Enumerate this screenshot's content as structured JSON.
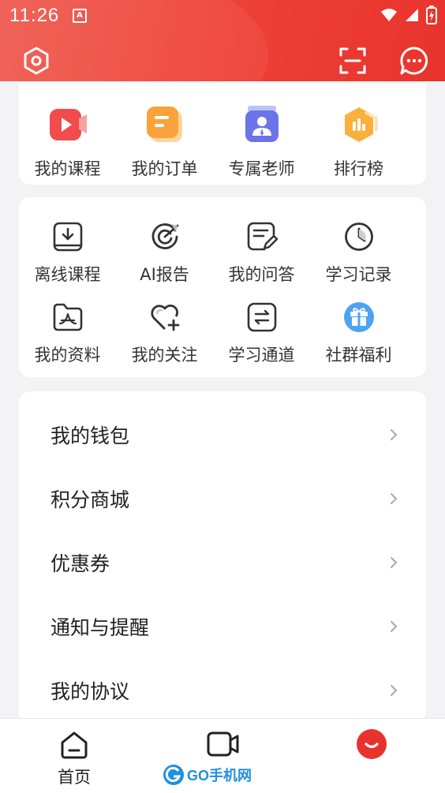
{
  "status_bar": {
    "time": "11:26",
    "app_badge": "A"
  },
  "top_actions": [
    {
      "label": "我的课程",
      "icon": "video-course-icon"
    },
    {
      "label": "我的订单",
      "icon": "order-icon"
    },
    {
      "label": "专属老师",
      "icon": "teacher-icon"
    },
    {
      "label": "排行榜",
      "icon": "ranking-icon"
    }
  ],
  "tools": [
    {
      "label": "离线课程",
      "icon": "download-icon"
    },
    {
      "label": "AI报告",
      "icon": "ai-report-icon"
    },
    {
      "label": "我的问答",
      "icon": "qa-edit-icon"
    },
    {
      "label": "学习记录",
      "icon": "clock-icon"
    },
    {
      "label": "我的资料",
      "icon": "folder-icon"
    },
    {
      "label": "我的关注",
      "icon": "heart-add-icon"
    },
    {
      "label": "学习通道",
      "icon": "exchange-icon"
    },
    {
      "label": "社群福利",
      "icon": "gift-icon"
    }
  ],
  "menu": [
    {
      "label": "我的钱包"
    },
    {
      "label": "积分商城"
    },
    {
      "label": "优惠券"
    },
    {
      "label": "通知与提醒"
    },
    {
      "label": "我的协议"
    }
  ],
  "tabbar": [
    {
      "label": "首页",
      "icon": "home-icon"
    },
    {
      "label": "",
      "icon": "video-camera-icon"
    },
    {
      "label": "",
      "icon": "profile-smile-icon"
    }
  ],
  "watermark": {
    "text": "GO手机网"
  },
  "colors": {
    "accent": "#ee3f36",
    "text": "#222222",
    "background": "#f3f3f5"
  }
}
